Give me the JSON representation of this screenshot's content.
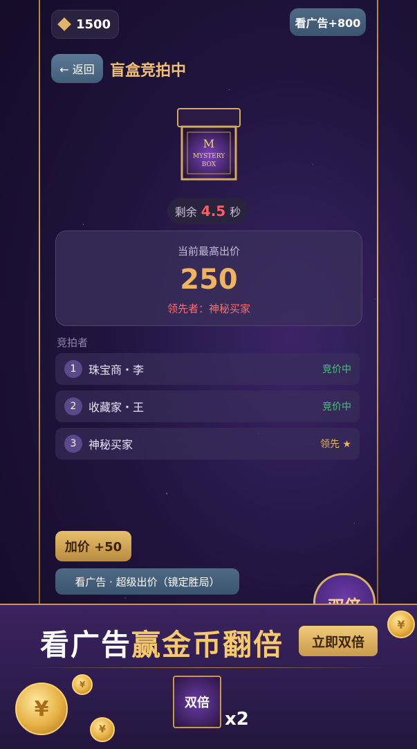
{
  "header": {
    "coins": "1500",
    "ad_button": "看广告+800",
    "back_button": "← 返回",
    "title": "盲盒竞拍中"
  },
  "mystery_box": {
    "line1": "M",
    "line2": "MYSTERY",
    "line3": "BOX"
  },
  "timer": {
    "prefix": "剩余",
    "value": "4.5",
    "suffix": "秒"
  },
  "bid": {
    "label": "当前最高出价",
    "value": "250",
    "leader": "领先者：神秘买家"
  },
  "bidders": {
    "label": "竞拍者",
    "rows": [
      {
        "rank": "1",
        "name": "珠宝商・李",
        "status": "竞价中"
      },
      {
        "rank": "2",
        "name": "收藏家・王",
        "status": "竞价中"
      },
      {
        "rank": "3",
        "name": "神秘买家",
        "status": "领先 ★"
      }
    ]
  },
  "actions": {
    "raise": "加价 +50",
    "super": "看广告 · 超级出价（镜定胜局）",
    "double_badge": "双倍"
  },
  "banner": {
    "title_part1": "看广告",
    "title_part2": "赢金币翻倍",
    "button": "立即双倍",
    "box_label": "双倍",
    "multiplier": "x2"
  },
  "colors": {
    "gold": "#f0c070",
    "accent_red": "#ff5c5c",
    "status_green": "#4ec27e"
  }
}
